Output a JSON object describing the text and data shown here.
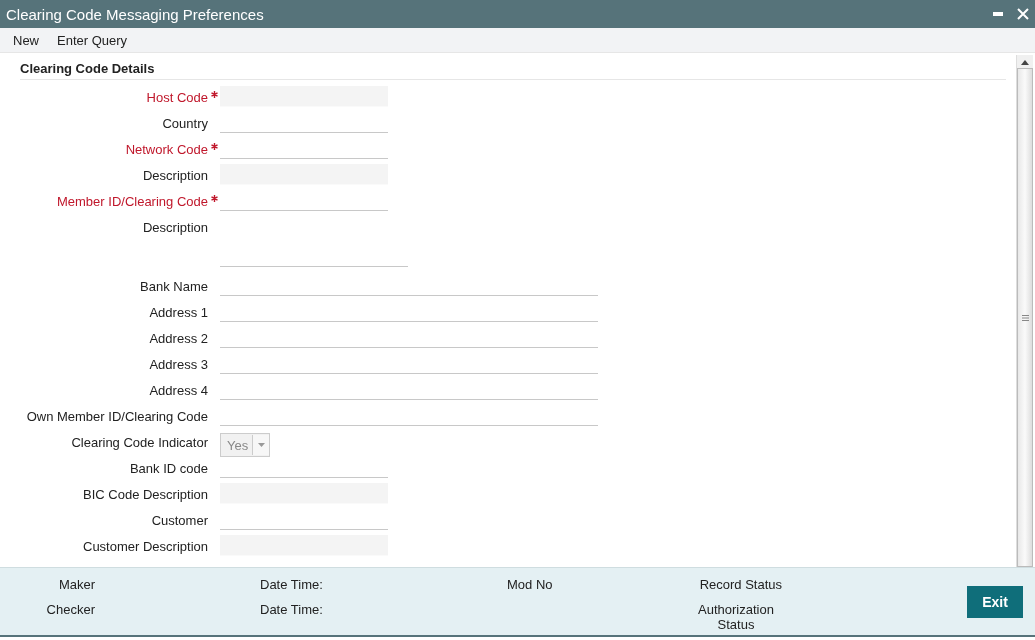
{
  "window": {
    "title": "Clearing Code Messaging Preferences"
  },
  "menu": [
    "New",
    "Enter Query"
  ],
  "section": {
    "title": "Clearing Code Details"
  },
  "fields": [
    {
      "label": "Host Code",
      "required": true,
      "kind": "readonly",
      "wide": false
    },
    {
      "label": "Country",
      "required": false,
      "kind": "text",
      "wide": false
    },
    {
      "label": "Network Code",
      "required": true,
      "kind": "text",
      "wide": false
    },
    {
      "label": "Description",
      "required": false,
      "kind": "readonly",
      "wide": false
    },
    {
      "label": "Member ID/Clearing Code",
      "required": true,
      "kind": "text",
      "wide": false
    },
    {
      "label": "Description",
      "required": false,
      "kind": "textarea",
      "wide": false
    },
    {
      "label": "Bank Name",
      "required": false,
      "kind": "text",
      "wide": true
    },
    {
      "label": "Address 1",
      "required": false,
      "kind": "text",
      "wide": true
    },
    {
      "label": "Address 2",
      "required": false,
      "kind": "text",
      "wide": true
    },
    {
      "label": "Address 3",
      "required": false,
      "kind": "text",
      "wide": true
    },
    {
      "label": "Address 4",
      "required": false,
      "kind": "text",
      "wide": true
    },
    {
      "label": "Own Member ID/Clearing Code",
      "required": false,
      "kind": "text",
      "wide": true
    },
    {
      "label": "Clearing Code Indicator",
      "required": false,
      "kind": "select",
      "wide": false,
      "value": "Yes"
    },
    {
      "label": "Bank ID code",
      "required": false,
      "kind": "text",
      "wide": false
    },
    {
      "label": "BIC Code Description",
      "required": false,
      "kind": "readonly",
      "wide": false
    },
    {
      "label": "Customer",
      "required": false,
      "kind": "text",
      "wide": false
    },
    {
      "label": "Customer Description",
      "required": false,
      "kind": "readonly",
      "wide": false
    }
  ],
  "footer": {
    "maker": "Maker",
    "checker": "Checker",
    "date_time_1": "Date Time:",
    "date_time_2": "Date Time:",
    "mod_no": "Mod No",
    "record_status": "Record Status",
    "authorization_status": "Authorization Status",
    "exit_button": "Exit"
  }
}
